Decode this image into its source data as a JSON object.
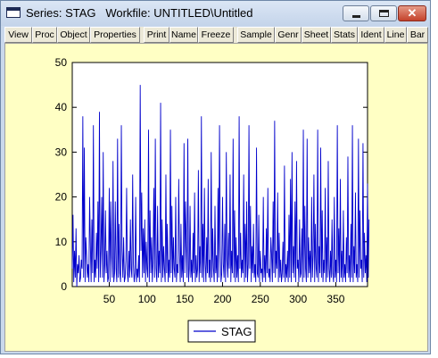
{
  "window": {
    "title": "Series: STAG   Workfile: UNTITLED\\Untitled",
    "minimize_icon": "minimize-icon",
    "maximize_icon": "maximize-icon",
    "close_icon": "close-icon",
    "close_glyph": "✕",
    "close_color": "#c4422b"
  },
  "toolbar": {
    "buttons": [
      "View",
      "Proc",
      "Object",
      "Properties",
      "Print",
      "Name",
      "Freeze",
      "Sample",
      "Genr",
      "Sheet",
      "Stats",
      "Ident",
      "Line",
      "Bar"
    ]
  },
  "colors": {
    "plot_background": "#ffffc4",
    "series_line": "#0000cc"
  },
  "chart_data": {
    "type": "line",
    "xlim": [
      1,
      392
    ],
    "ylim": [
      0,
      50
    ],
    "xticks": [
      50,
      100,
      150,
      200,
      250,
      300,
      350
    ],
    "yticks": [
      0,
      10,
      20,
      30,
      40,
      50
    ],
    "legend_position": "bottom-center",
    "grid": false,
    "series": [
      {
        "name": "STAG",
        "color": "#0000cc",
        "values": [
          4,
          16,
          1,
          8,
          2,
          13,
          0,
          5,
          3,
          7,
          1,
          2,
          6,
          4,
          38,
          2,
          31,
          1,
          11,
          7,
          2,
          5,
          1,
          20,
          9,
          1,
          15,
          3,
          36,
          1,
          6,
          2,
          12,
          4,
          19,
          1,
          39,
          2,
          8,
          20,
          2,
          30,
          1,
          5,
          17,
          3,
          8,
          1,
          2,
          22,
          1,
          19,
          7,
          2,
          28,
          1,
          3,
          19,
          4,
          1,
          33,
          2,
          14,
          3,
          1,
          36,
          8,
          2,
          11,
          1,
          2,
          6,
          22,
          3,
          1,
          8,
          2,
          15,
          4,
          2,
          25,
          5,
          1,
          3,
          20,
          1,
          4,
          2,
          7,
          1,
          45,
          8,
          21,
          2,
          13,
          3,
          15,
          1,
          10,
          4,
          2,
          35,
          1,
          17,
          3,
          11,
          1,
          6,
          22,
          2,
          33,
          4,
          1,
          18,
          2,
          8,
          3,
          41,
          1,
          15,
          2,
          9,
          4,
          1,
          25,
          3,
          14,
          1,
          6,
          2,
          35,
          3,
          18,
          1,
          11,
          4,
          2,
          20,
          1,
          5,
          3,
          24,
          8,
          1,
          14,
          2,
          7,
          1,
          32,
          3,
          19,
          9,
          2,
          33,
          1,
          4,
          18,
          2,
          6,
          1,
          12,
          3,
          21,
          1,
          7,
          2,
          4,
          26,
          1,
          9,
          3,
          38,
          2,
          14,
          1,
          22,
          5,
          1,
          11,
          3,
          24,
          2,
          6,
          1,
          30,
          2,
          13,
          4,
          1,
          18,
          3,
          7,
          1,
          22,
          2,
          36,
          9,
          1,
          3,
          20,
          5,
          2,
          14,
          1,
          30,
          6,
          2,
          12,
          4,
          25,
          1,
          8,
          3,
          33,
          2,
          17,
          1,
          11,
          2,
          7,
          1,
          38,
          4,
          12,
          2,
          6,
          3,
          25,
          1,
          14,
          2,
          19,
          1,
          5,
          36,
          4,
          18,
          1,
          9,
          3,
          14,
          2,
          5,
          1,
          31,
          3,
          2,
          16,
          1,
          8,
          3,
          4,
          1,
          20,
          2,
          7,
          1,
          13,
          3,
          22,
          2,
          4,
          1,
          11,
          7,
          1,
          19,
          3,
          37,
          2,
          8,
          4,
          21,
          1,
          12,
          2,
          6,
          1,
          3,
          10,
          2,
          27,
          1,
          5,
          2,
          8,
          1,
          16,
          2,
          24,
          1,
          30,
          3,
          9,
          2,
          19,
          1,
          28,
          4,
          6,
          1,
          15,
          2,
          3,
          13,
          1,
          35,
          2,
          18,
          4,
          1,
          33,
          2,
          11,
          3,
          8,
          1,
          20,
          2,
          7,
          25,
          1,
          14,
          4,
          2,
          35,
          1,
          9,
          3,
          31,
          2,
          17,
          1,
          6,
          3,
          22,
          1,
          11,
          2,
          28,
          4,
          1,
          8,
          2,
          15,
          3,
          1,
          20,
          2,
          6,
          1,
          36,
          3,
          13,
          1,
          24,
          2,
          8,
          1,
          17,
          2,
          5,
          1,
          11,
          3,
          29,
          2,
          7,
          1,
          14,
          2,
          36,
          1,
          9,
          3,
          21,
          2,
          5,
          1,
          33,
          2,
          17,
          4,
          6,
          1,
          32,
          2,
          12,
          3,
          7,
          1,
          23,
          2,
          15
        ]
      }
    ]
  }
}
